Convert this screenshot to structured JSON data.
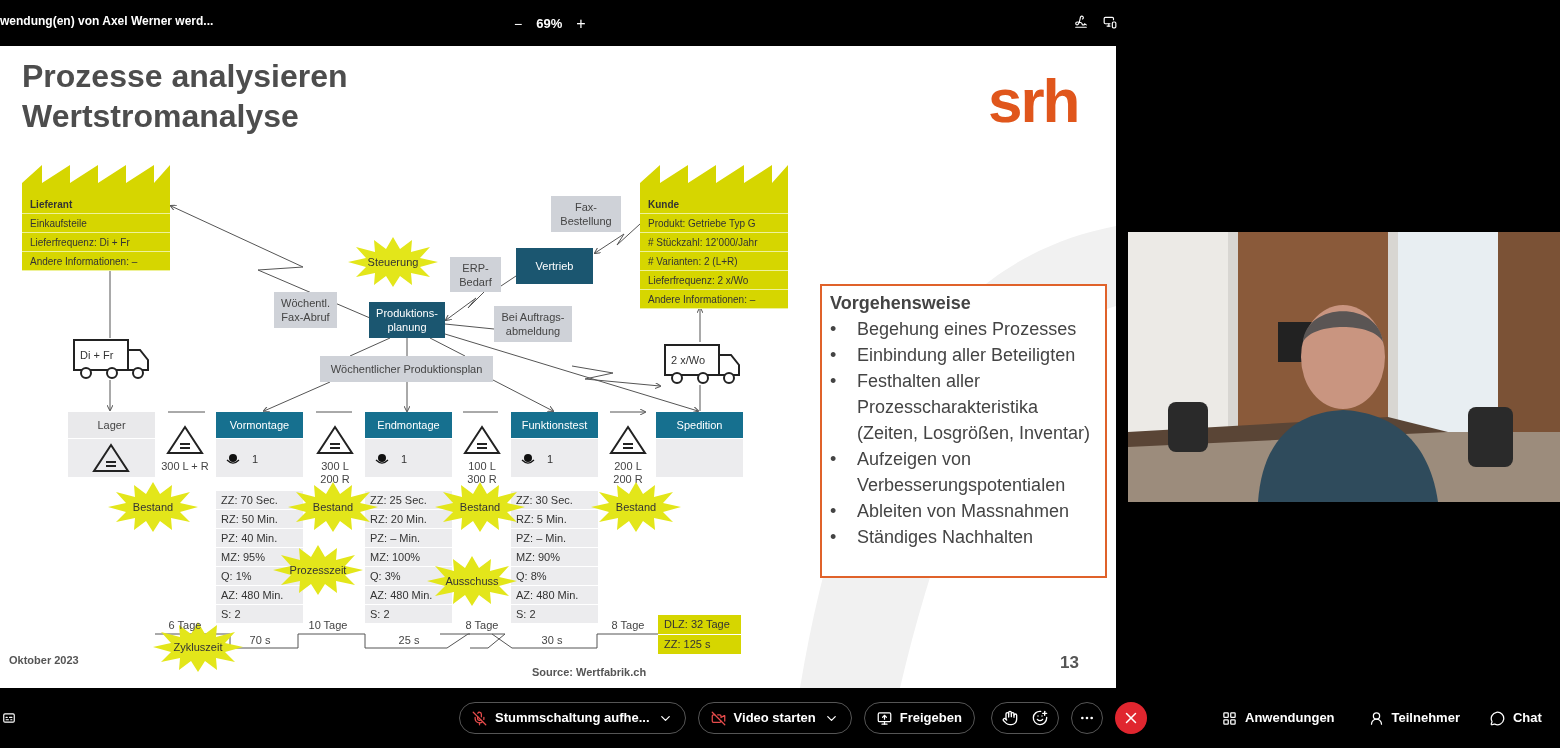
{
  "top_bar": {
    "title": "wendung(en) von Axel Werner werd...",
    "zoom_out": "−",
    "zoom": "69%",
    "zoom_in": "+"
  },
  "slide": {
    "title_lines": [
      "Prozesse analysieren",
      "Wertstromanalyse"
    ],
    "logo": "srh",
    "supplier": {
      "lines": [
        "Lieferant",
        "Einkaufsteile",
        "Lieferfrequenz: Di + Fr",
        "Andere Informationen: –"
      ]
    },
    "customer": {
      "lines": [
        "Kunde",
        "Produkt: Getriebe Typ G",
        "# Stückzahl: 12’000/Jahr",
        "# Varianten: 2 (L+R)",
        "Lieferfrequenz: 2 x/Wo",
        "Andere Informationen: –"
      ]
    },
    "info_boxes": [
      {
        "lines": [
          "Fax-",
          "Bestellung"
        ]
      },
      {
        "lines": [
          "ERP-",
          "Bedarf"
        ]
      },
      {
        "lines": [
          "Wöchentl.",
          "Fax-Abruf"
        ]
      },
      {
        "lines": [
          "Bei Auftrags-",
          "abmeldung"
        ]
      },
      {
        "lines": [
          "Wöchentlicher Produktionsplan"
        ]
      }
    ],
    "control_boxes": [
      {
        "lines": [
          "Vertrieb"
        ]
      },
      {
        "lines": [
          "Produktions-",
          "planung"
        ]
      }
    ],
    "trucks": [
      "Di + Fr",
      "2 x/Wo"
    ],
    "steps": [
      {
        "kind": "storage",
        "name": "Lager"
      },
      {
        "kind": "process",
        "name": "Vormontage",
        "operators": "1",
        "data": [
          "ZZ: 70 Sec.",
          "RZ: 50 Min.",
          "PZ: 40 Min.",
          "MZ: 95%",
          "Q: 1%",
          "AZ: 480 Min.",
          "S: 2"
        ]
      },
      {
        "kind": "process",
        "name": "Endmontage",
        "operators": "1",
        "data": [
          "ZZ: 25 Sec.",
          "RZ: 20 Min.",
          "PZ: – Min.",
          "MZ: 100%",
          "Q: 3%",
          "AZ: 480 Min.",
          "S: 2"
        ]
      },
      {
        "kind": "process",
        "name": "Funktionstest",
        "operators": "1",
        "data": [
          "ZZ: 30 Sec.",
          "RZ: 5 Min.",
          "PZ: – Min.",
          "MZ: 90%",
          "Q: 8%",
          "AZ: 480 Min.",
          "S: 2"
        ]
      },
      {
        "kind": "shipping",
        "name": "Spedition"
      }
    ],
    "inventories": [
      [
        "300 L + R"
      ],
      [
        "300 L",
        "200 R"
      ],
      [
        "100 L",
        "300 R"
      ],
      [
        "200 L",
        "200 R"
      ]
    ],
    "bursts": [
      "Steuerung",
      "Bestand",
      "Bestand",
      "Bestand",
      "Bestand",
      "Prozesszeit",
      "Ausschuss",
      "Zykluszeit"
    ],
    "timeline": {
      "waits": [
        "6 Tage",
        "10 Tage",
        "8 Tage",
        "8 Tage"
      ],
      "cycles": [
        "70 s",
        "25 s",
        "30 s"
      ],
      "totals": [
        "DLZ: 32 Tage",
        "ZZ: 125 s"
      ]
    },
    "procedure": {
      "title": "Vorgehensweise",
      "bullet": "•",
      "items": [
        "Begehung eines Prozesses",
        "Einbindung aller Beteiligten",
        "Festhalten aller Prozesscharakteristika (Zeiten, Losgrößen, Inventar)",
        "Aufzeigen von Verbesserungspotentialen",
        "Ableiten von Massnahmen",
        "Ständiges Nachhalten"
      ]
    },
    "date": "Oktober 2023",
    "source": "Source: Wertfabrik.ch",
    "page": "13"
  },
  "bottom_bar": {
    "mute": "Stummschaltung aufhe...",
    "video": "Video starten",
    "share": "Freigeben",
    "apps": "Anwendungen",
    "participants": "Teilnehmer",
    "chat": "Chat"
  }
}
